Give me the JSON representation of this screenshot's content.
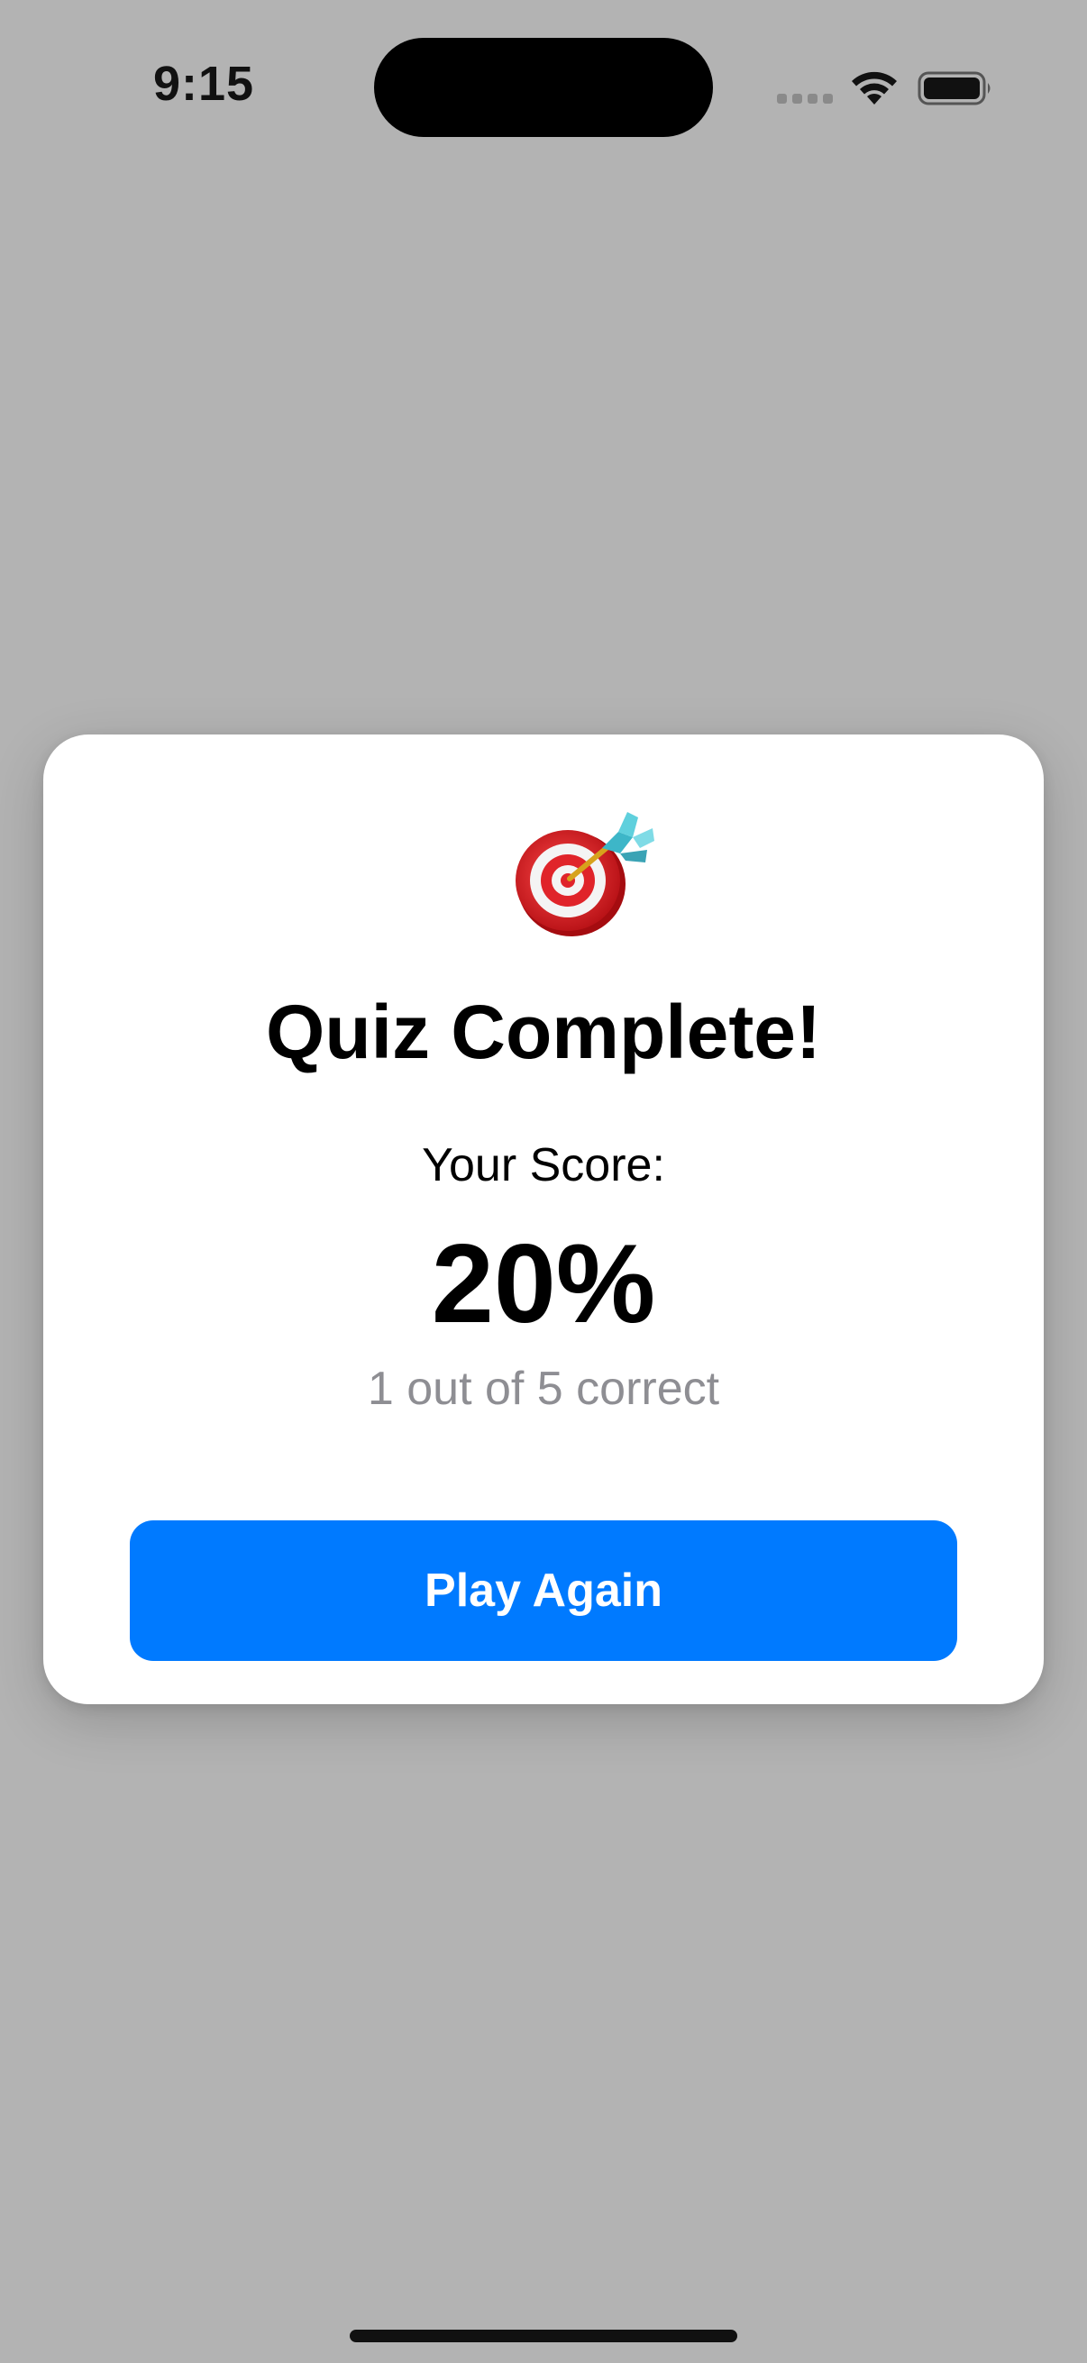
{
  "status_bar": {
    "time": "9:15",
    "icons": [
      "signal-dots-icon",
      "wifi-icon",
      "battery-icon"
    ]
  },
  "modal": {
    "icon": "direct-hit-target-icon",
    "title": "Quiz Complete!",
    "score_label": "Your Score:",
    "score_value": "20%",
    "score_detail": "1 out of 5 correct",
    "button_label": "Play Again"
  },
  "colors": {
    "backdrop": "#b3b3b3",
    "card": "#ffffff",
    "button": "#007aff",
    "secondary_text": "#8e8e93"
  }
}
